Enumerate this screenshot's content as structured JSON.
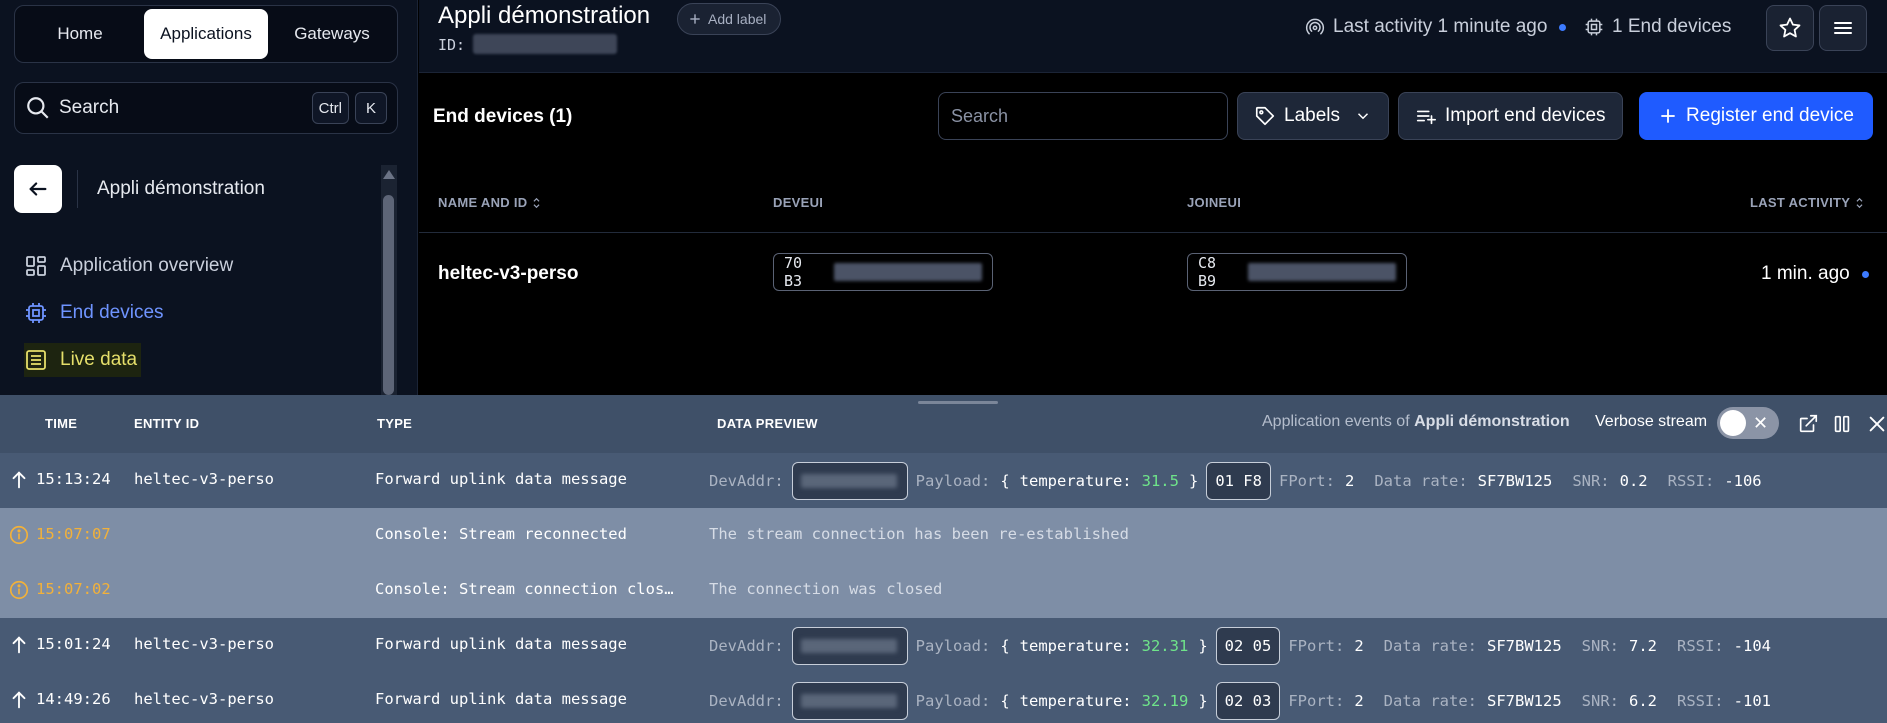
{
  "nav": {
    "tabs": [
      {
        "label": "Home"
      },
      {
        "label": "Applications"
      },
      {
        "label": "Gateways"
      }
    ],
    "search_label": "Search",
    "kbd_ctrl": "Ctrl",
    "kbd_k": "K"
  },
  "sidebar": {
    "app_name": "Appli démonstration",
    "items": [
      {
        "label": "Application overview",
        "icon": "grid-icon"
      },
      {
        "label": "End devices",
        "icon": "chip-icon"
      },
      {
        "label": "Live data",
        "icon": "list-icon"
      }
    ]
  },
  "header": {
    "title": "Appli démonstration",
    "add_label": "Add label",
    "id_label": "ID:",
    "last_activity": "Last activity 1 minute ago",
    "end_devices_count": "1 End devices"
  },
  "main": {
    "title": "End devices (1)",
    "search_placeholder": "Search",
    "labels_button": "Labels",
    "import_button": "Import end devices",
    "register_button": "Register end device",
    "columns": [
      "NAME AND ID",
      "DEVEUI",
      "JOINEUI",
      "LAST ACTIVITY"
    ],
    "rows": [
      {
        "name": "heltec-v3-perso",
        "deveui_prefix": "70 B3",
        "joineui_prefix": "C8 B9",
        "last_activity": "1 min. ago"
      }
    ]
  },
  "events": {
    "columns": [
      "TIME",
      "ENTITY ID",
      "TYPE",
      "DATA PREVIEW"
    ],
    "of_prefix": "Application events of",
    "of_app": "Appli démonstration",
    "verbose_label": "Verbose stream",
    "rows": [
      {
        "kind": "uplink",
        "time": "15:13:24",
        "entity": "heltec-v3-perso",
        "type": "Forward uplink data message",
        "devaddr_label": "DevAddr:",
        "payload_label": "Payload:",
        "temp_key": "temperature:",
        "temp_val": "31.5",
        "hex": "01 F8",
        "fport_label": "FPort:",
        "fport": "2",
        "dr_label": "Data rate:",
        "dr": "SF7BW125",
        "snr_label": "SNR:",
        "snr": "0.2",
        "rssi_label": "RSSI:",
        "rssi": "-106"
      },
      {
        "kind": "console",
        "time": "15:07:07",
        "type": "Console: Stream reconnected",
        "message": "The stream connection has been re-established"
      },
      {
        "kind": "console",
        "time": "15:07:02",
        "type": "Console: Stream connection clos…",
        "message": "The connection was closed"
      },
      {
        "kind": "uplink",
        "time": "15:01:24",
        "entity": "heltec-v3-perso",
        "type": "Forward uplink data message",
        "devaddr_label": "DevAddr:",
        "payload_label": "Payload:",
        "temp_key": "temperature:",
        "temp_val": "32.31",
        "hex": "02 05",
        "fport_label": "FPort:",
        "fport": "2",
        "dr_label": "Data rate:",
        "dr": "SF7BW125",
        "snr_label": "SNR:",
        "snr": "7.2",
        "rssi_label": "RSSI:",
        "rssi": "-104"
      },
      {
        "kind": "uplink",
        "time": "14:49:26",
        "entity": "heltec-v3-perso",
        "type": "Forward uplink data message",
        "devaddr_label": "DevAddr:",
        "payload_label": "Payload:",
        "temp_key": "temperature:",
        "temp_val": "32.19",
        "hex": "02 03",
        "fport_label": "FPort:",
        "fport": "2",
        "dr_label": "Data rate:",
        "dr": "SF7BW125",
        "snr_label": "SNR:",
        "snr": "6.2",
        "rssi_label": "RSSI:",
        "rssi": "-101"
      }
    ]
  },
  "colors": {
    "accent": "#1f5bff",
    "active_nav": "#6f94ff",
    "live_nav": "#e5df6a",
    "warn": "#f2b13a",
    "value_green": "#6fe48a"
  }
}
